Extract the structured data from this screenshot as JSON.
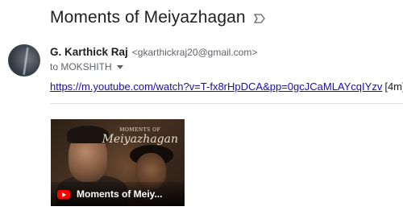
{
  "email": {
    "subject": "Moments of Meiyazhagan",
    "sender_name": "G. Karthick Raj",
    "sender_email": "<gkarthickraj20@gmail.com>",
    "to_text": "to MOKSHITH",
    "link": "https://m.youtube.com/watch?v=T-fx8rHpDCA&pp=0gcJCaMLAYcqIYzv",
    "duration": "[4m]"
  },
  "video_card": {
    "title": "Moments of Meiy...",
    "thumbnail_small": "MOMENTS OF",
    "thumbnail_big": "Meiyazhagan"
  },
  "icons": {
    "label": "label-outline-icon",
    "youtube": "youtube-icon",
    "dropdown": "chevron-down-icon"
  },
  "colors": {
    "link": "#1a0dab",
    "youtube_red": "#ff0000"
  }
}
